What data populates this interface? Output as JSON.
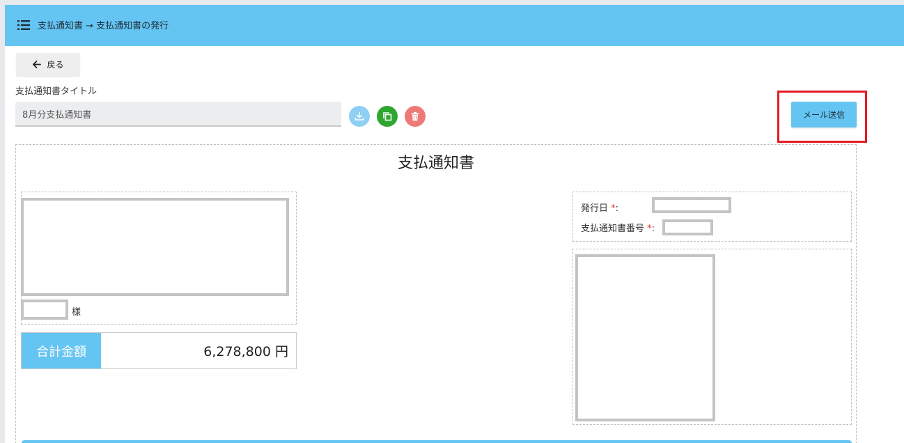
{
  "header": {
    "breadcrumb": "支払通知書 → 支払通知書の発行",
    "menu_icon": "list-icon"
  },
  "toolbar": {
    "back_label": "戻る",
    "title_field_label": "支払通知書タイトル",
    "title_value": "8月分支払通知書",
    "download_icon": "download-icon",
    "copy_icon": "copy-icon",
    "delete_icon": "trash-icon",
    "mail_button_label": "メール送信"
  },
  "document": {
    "heading": "支払通知書",
    "recipient_suffix": "様",
    "total_label": "合計金額",
    "total_value": "6,278,800 円",
    "issue_date_label": "発行日",
    "notice_number_label": "支払通知書番号",
    "required_mark": "*",
    "colon": ":"
  },
  "colors": {
    "accent": "#64c4f2",
    "highlight": "#e31b23",
    "copy_button": "#2ea62f",
    "delete_button": "#ee7a78"
  }
}
